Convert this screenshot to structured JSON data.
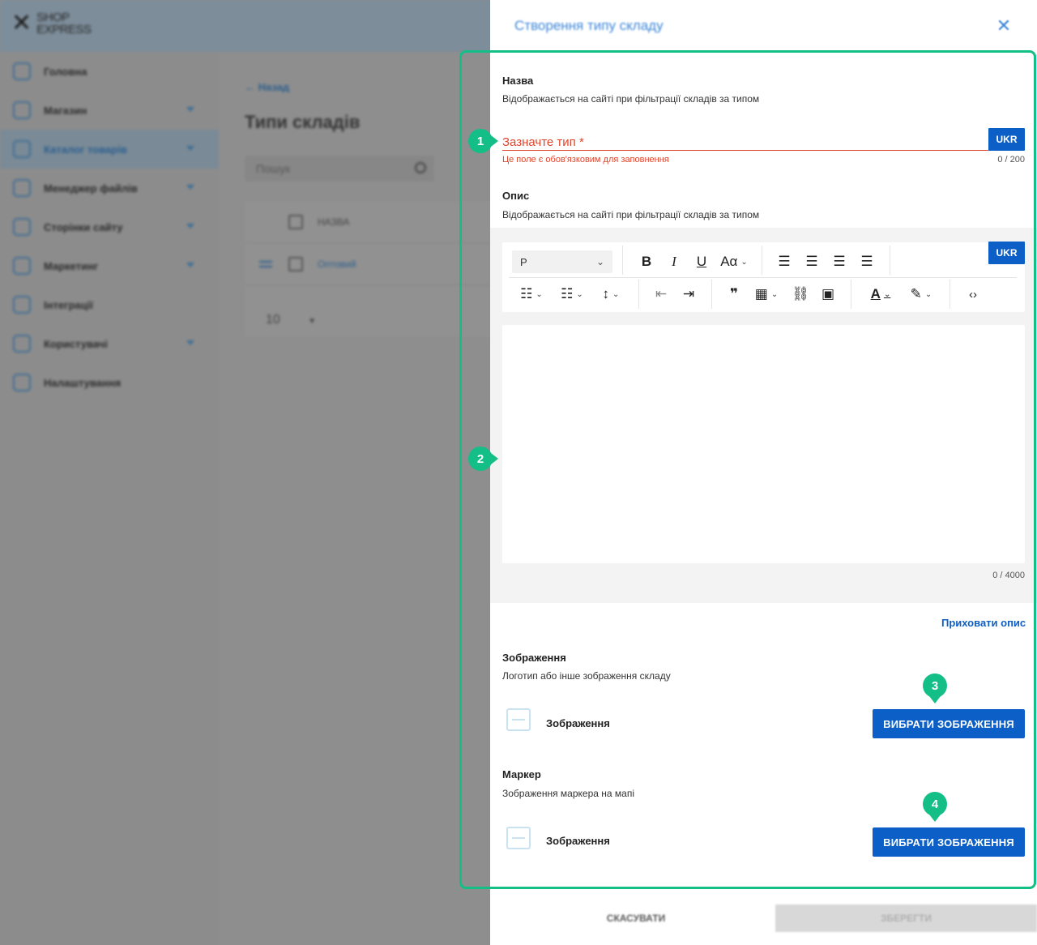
{
  "app": {
    "logo_line1": "SHOP",
    "logo_line2": "EXPRESS",
    "sidebar": {
      "items": [
        {
          "label": "Головна",
          "icon": "home-icon"
        },
        {
          "label": "Магазин",
          "icon": "cart-icon"
        },
        {
          "label": "Каталог товарів",
          "icon": "book-icon"
        },
        {
          "label": "Менеджер файлів",
          "icon": "folder-icon"
        },
        {
          "label": "Сторінки сайту",
          "icon": "pages-icon"
        },
        {
          "label": "Маркетинг",
          "icon": "tag-icon"
        },
        {
          "label": "Інтеграції",
          "icon": "megaphone-icon"
        },
        {
          "label": "Користувачі",
          "icon": "user-icon"
        },
        {
          "label": "Налаштування",
          "icon": "gear-icon"
        }
      ]
    },
    "main": {
      "back_label": "Назад",
      "page_title": "Типи складів",
      "search_placeholder": "Пошук",
      "table": {
        "column_name": "НАЗВА",
        "rows": [
          "Оптовий"
        ]
      },
      "page_size": "10"
    }
  },
  "drawer": {
    "title": "Створення типу складу",
    "name_section": {
      "label": "Назва",
      "hint": "Відображається на сайті при фільтрації складів за типом",
      "placeholder": "Зазначте тип *",
      "lang": "UKR",
      "error": "Це поле є обов'язковим для заповнення",
      "counter": "0 / 200"
    },
    "description_section": {
      "label": "Опис",
      "hint": "Відображається на сайті при фільтрації складів за типом",
      "lang": "UKR",
      "paragraph_style": "P",
      "counter": "0 / 4000",
      "hide_link": "Приховати опис"
    },
    "image_section": {
      "label": "Зображення",
      "hint": "Логотип або інше зображення складу",
      "image_label": "Зображення",
      "button": "ВИБРАТИ ЗОБРАЖЕННЯ"
    },
    "marker_section": {
      "label": "Маркер",
      "hint": "Зображення маркера на мапі",
      "image_label": "Зображення",
      "button": "ВИБРАТИ ЗОБРАЖЕННЯ"
    },
    "footer": {
      "cancel": "СКАСУВАТИ",
      "save": "ЗБЕРЕГТИ"
    }
  },
  "annotations": [
    "1",
    "2",
    "3",
    "4"
  ],
  "colors": {
    "accent": "#0b5fc6",
    "error": "#e0452c",
    "highlight": "#13bf86",
    "title_blue": "#3d86d8"
  }
}
